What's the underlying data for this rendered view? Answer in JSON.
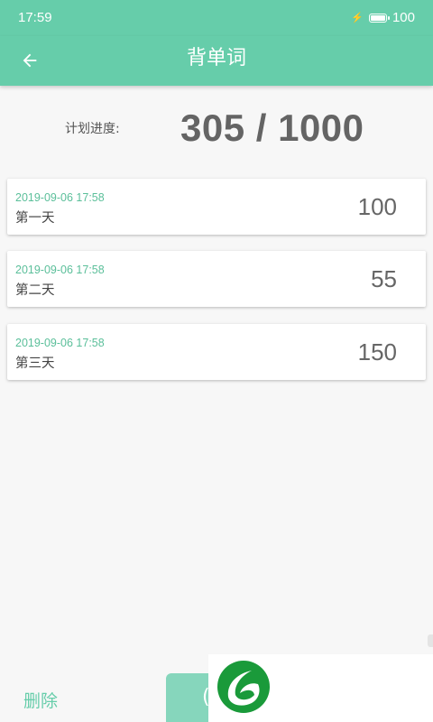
{
  "status_bar": {
    "time": "17:59",
    "battery": "100"
  },
  "toolbar": {
    "title": "背单词"
  },
  "progress": {
    "label": "计划进度:",
    "value": "305 / 1000"
  },
  "records": [
    {
      "date": "2019-09-06 17:58",
      "day": "第一天",
      "count": "100"
    },
    {
      "date": "2019-09-06 17:58",
      "day": "第二天",
      "count": "55"
    },
    {
      "date": "2019-09-06 17:58",
      "day": "第三天",
      "count": "150"
    }
  ],
  "bottom": {
    "delete_label": "删除"
  },
  "colors": {
    "accent": "#66cdaa",
    "date_text": "#5bbf9a",
    "logo_green": "#1a9a3a"
  }
}
